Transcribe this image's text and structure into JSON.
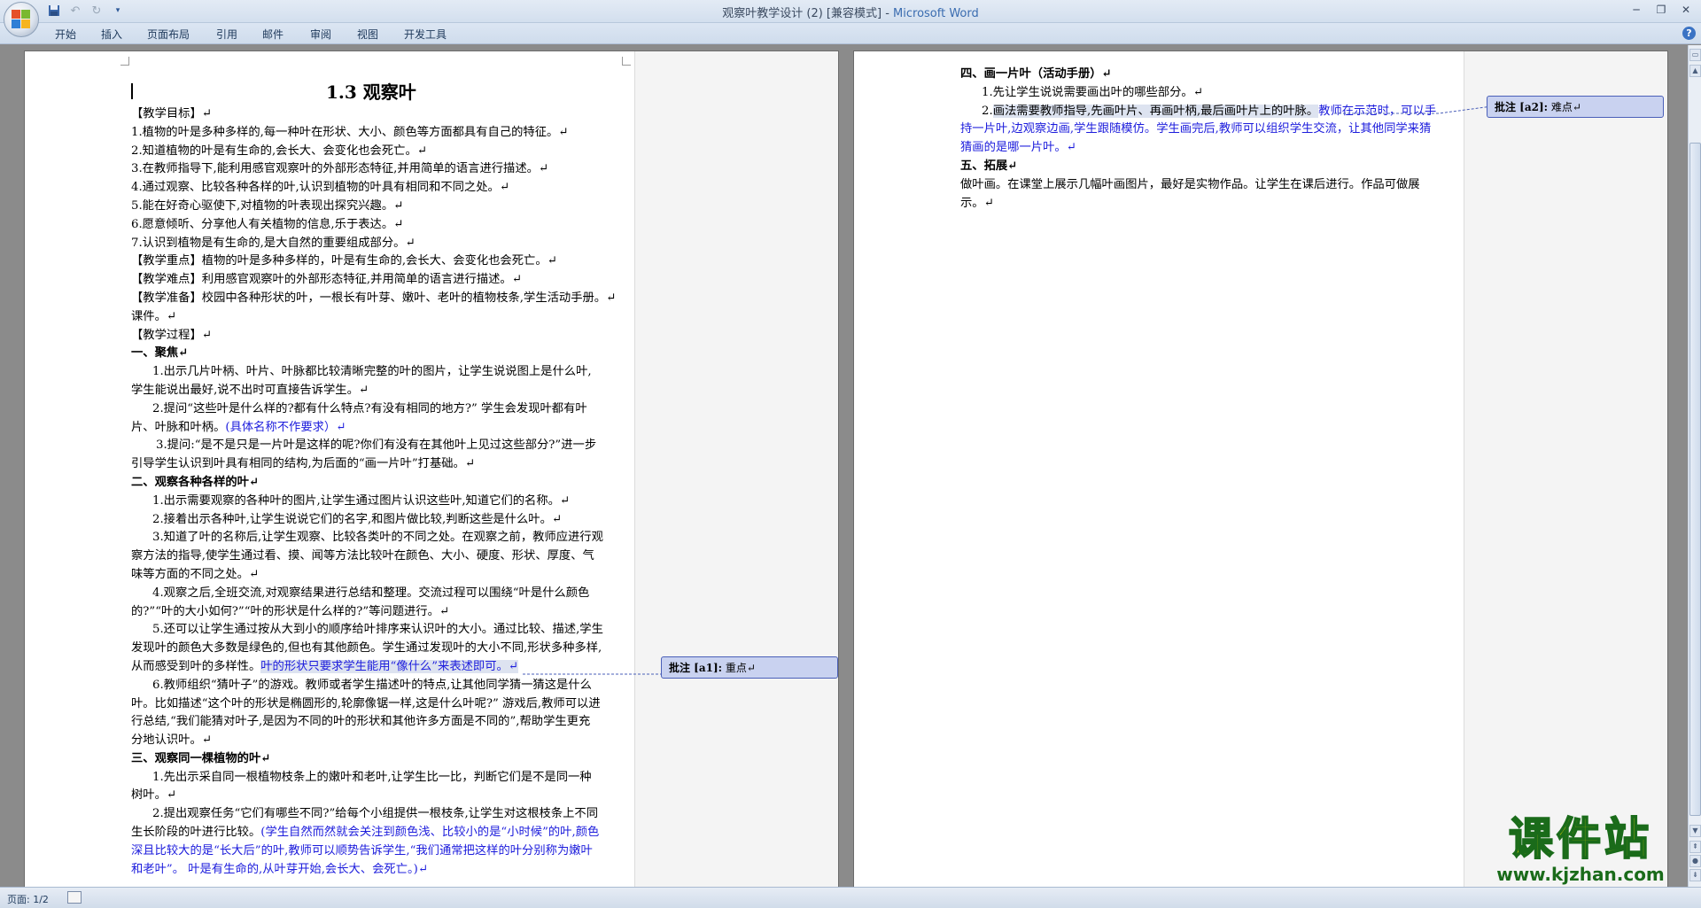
{
  "window": {
    "title_doc": "观察叶教学设计 (2) [兼容模式] - ",
    "title_app": "Microsoft Word"
  },
  "ribbon": {
    "tabs": [
      "开始",
      "插入",
      "页面布局",
      "引用",
      "邮件",
      "审阅",
      "视图",
      "开发工具"
    ]
  },
  "page1": {
    "title": "1.3 观察叶",
    "lines": [
      "【教学目标】↵",
      "1.植物的叶是多种多样的,每一种叶在形状、大小、颜色等方面都具有自己的特征。↵",
      "2.知道植物的叶是有生命的,会长大、会变化也会死亡。↵",
      "3.在教师指导下,能利用感官观察叶的外部形态特征,并用简单的语言进行描述。↵",
      "4.通过观察、比较各种各样的叶,认识到植物的叶具有相同和不同之处。↵",
      "5.能在好奇心驱使下,对植物的叶表现出探究兴趣。↵",
      "6.愿意倾听、分享他人有关植物的信息,乐于表达。↵",
      "7.认识到植物是有生命的,是大自然的重要组成部分。↵",
      "【教学重点】植物的叶是多种多样的，叶是有生命的,会长大、会变化也会死亡。↵",
      "【教学难点】利用感官观察叶的外部形态特征,并用简单的语言进行描述。↵",
      "【教学准备】校园中各种形状的叶，一根长有叶芽、嫩叶、老叶的植物枝条,学生活动手册。↵",
      "课件。↵",
      "【教学过程】↵"
    ],
    "section1_heading": "一、聚焦↵",
    "s1_p1": [
      "1.出示几片叶柄、叶片、叶脉都比较清晰完整的叶的图片，让学生说说图上是什么叶,",
      "学生能说出最好,说不出时可直接告诉学生。↵"
    ],
    "s1_p2_a": "2.提问“这些叶是什么样的?都有什么特点?有没有相同的地方?” 学生会发现叶都有叶",
    "s1_p2_b": "片、叶脉和叶柄。",
    "s1_p2_blue": "(具体名称不作要求）↵",
    "s1_p3": [
      "3.提问:“是不是只是一片叶是这样的呢?你们有没有在其他叶上见过这些部分?”进一步",
      "引导学生认识到叶具有相同的结构,为后面的“画一片叶”打基础。↵"
    ],
    "section2_heading": "二、观察各种各样的叶↵",
    "s2_p1": "1.出示需要观察的各种叶的图片,让学生通过图片认识这些叶,知道它们的名称。↵",
    "s2_p2": "2.接着出示各种叶,让学生说说它们的名字,和图片做比较,判断这些是什么叶。↵",
    "s2_p3": [
      "3.知道了叶的名称后,让学生观察、比较各类叶的不同之处。在观察之前，教师应进行观",
      "察方法的指导,使学生通过看、摸、闻等方法比较叶在颜色、大小、硬度、形状、厚度、气",
      "味等方面的不同之处。↵"
    ],
    "s2_p4": [
      "4.观察之后,全班交流,对观察结果进行总结和整理。交流过程可以围绕“叶是什么颜色",
      "的?”“叶的大小如何?”“叶的形状是什么样的?”等问题进行。↵"
    ],
    "s2_p5": [
      "5.还可以让学生通过按从大到小的顺序给叶排序来认识叶的大小。通过比较、描述,学生",
      "发现叶的颜色大多数是绿色的,但也有其他颜色。学生通过发现叶的大小不同,形状多种多样,"
    ],
    "s2_p5_last_a": "从而感受到叶的多样性。",
    "s2_p5_last_hl": "叶的形状只要求学生能用“像什么”来表述即可。↵",
    "s2_p6": [
      "6.教师组织“猜叶子”的游戏。教师或者学生描述叶的特点,让其他同学猜一猜这是什么",
      "叶。比如描述“这个叶的形状是椭圆形的,轮廓像锯一样,这是什么叶呢?” 游戏后,教师可以进",
      "行总结,“我们能猜对叶子,是因为不同的叶的形状和其他许多方面是不同的”,帮助学生更充",
      "分地认识叶。↵"
    ],
    "section3_heading": "三、观察同一棵植物的叶↵",
    "s3_p1": [
      "1.先出示采自同一根植物枝条上的嫩叶和老叶,让学生比一比，判断它们是不是同一种",
      "树叶。↵"
    ],
    "s3_p2_a": "2.提出观察任务“它们有哪些不同?”给每个小组提供一根枝条,让学生对这根枝条上不同",
    "s3_p2_b": "生长阶段的叶进行比较。",
    "s3_p2_blue_a": "(学生自然而然就会关注到颜色浅、比较小的是“小时候”的叶,颜色",
    "s3_p2_blue_b": "深且比较大的是“长大后”的叶,教师可以顺势告诉学生,“我们通常把这样的叶分别称为嫩叶",
    "s3_p2_blue_c": "和老叶”。 叶是有生命的,从叶芽开始,会长大、会死亡。)↵"
  },
  "page2": {
    "section4_heading": "四、画一片叶（活动手册）↵",
    "s4_p1": "1.先让学生说说需要画出叶的哪些部分。↵",
    "s4_p2_num": "2.",
    "s4_p2_hl": "画法需要教师指导,先画叶片、再画叶柄,最后画叶片上的叶脉。",
    "s4_p2_blue": "教师在示范时，可以手",
    "s4_p2_blue_b": "持一片叶,边观察边画,学生跟随模仿。学生画完后,教师可以组织学生交流，让其他同学来猜",
    "s4_p2_blue_c": "猜画的是哪一片叶。↵",
    "section5_heading": "五、拓展↵",
    "s5_p1": [
      "做叶画。在课堂上展示几幅叶画图片，最好是实物作品。让学生在课后进行。作品可做展",
      "示。↵"
    ]
  },
  "comments": [
    {
      "label": "批注 [a1]:",
      "text": " 重点↵"
    },
    {
      "label": "批注 [a2]:",
      "text": " 难点↵"
    }
  ],
  "status": {
    "page": "页面: 1/2"
  },
  "watermark": {
    "main": "课件站",
    "url": "www.kjzhan.com"
  }
}
